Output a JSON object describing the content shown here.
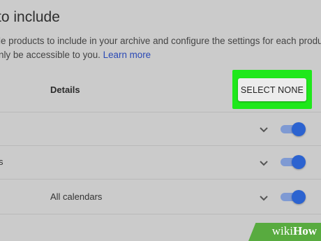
{
  "header": {
    "title": "to include",
    "description_line1": "le products to include in your archive and configure the settings for each product.",
    "description_line2_prefix": "nly be accessible to you.",
    "learn_more": "Learn more"
  },
  "table": {
    "details_header": "Details",
    "select_none_label": "SELECT NONE",
    "rows": [
      {
        "name": "",
        "details": "",
        "toggle_on": true
      },
      {
        "name": "s",
        "details": "",
        "toggle_on": true
      },
      {
        "name": "",
        "details": "All calendars",
        "toggle_on": true
      },
      {
        "name": "",
        "details": "",
        "toggle_on": true
      }
    ]
  },
  "watermark": {
    "wiki": "wiki",
    "how": "How"
  },
  "colors": {
    "highlight": "#1fe81b",
    "toggle_knob": "#2c63d0",
    "toggle_track": "#7f9ad3",
    "link": "#2a49b5"
  },
  "icons": [
    "chevron-down-icon",
    "toggle-switch"
  ]
}
